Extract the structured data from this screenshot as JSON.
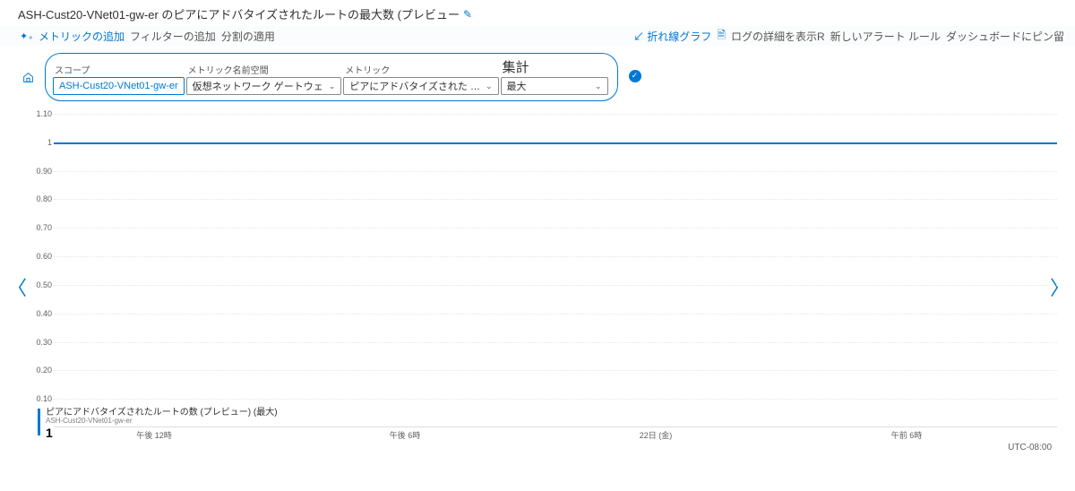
{
  "title": {
    "text": "ASH-Cust20-VNet01-gw-er のピアにアドバタイズされたルートの最大数 (プレビュー",
    "edit_icon": "✎"
  },
  "toolbar": {
    "left": {
      "add_metric": "メトリックの追加",
      "add_filter": "フィルターの追加",
      "apply_split": "分割の適用"
    },
    "right": {
      "chart_type_prefix": "↙",
      "chart_type": "折れ線グラフ",
      "log_detail": "ログの詳細を表示R",
      "new_alert": "新しいアラート ルール",
      "pin_board": "ダッシュボードにピン留"
    }
  },
  "selectors": {
    "scope": {
      "label": "スコープ",
      "value": "ASH-Cust20-VNet01-gw-er"
    },
    "namespace": {
      "label": "メトリック名前空間",
      "value": "仮想ネットワーク ゲートウェ"
    },
    "metric": {
      "label": "メトリック",
      "value": "ピアにアドバタイズされた …"
    },
    "aggregation": {
      "label": "集計",
      "value": "最大"
    }
  },
  "chart_data": {
    "type": "line",
    "ylim": [
      0,
      1.1
    ],
    "yticks": [
      "1.10",
      "1",
      "0.90",
      "0.80",
      "0.70",
      "0.60",
      "0.50",
      "0.40",
      "0.30",
      "0.20",
      "0.10"
    ],
    "xticks": [
      "午後 12時",
      "午後 6時",
      "22日 (金)",
      "午前 6時"
    ],
    "series": [
      {
        "name": "ピアにアドバタイズされたルートの数 (プレビュー) (最大)",
        "value_constant": 1
      }
    ],
    "utc_label": "UTC-08:00"
  },
  "legend": {
    "title": "ピアにアドバタイズされたルートの数 (プレビュー) (最大)",
    "sub": "ASH-Cust20-VNet01-gw-er",
    "value": "1"
  }
}
